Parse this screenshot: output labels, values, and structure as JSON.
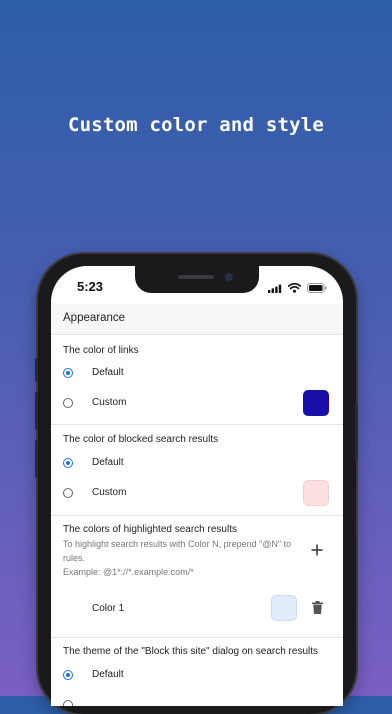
{
  "headline": "Custom color and style",
  "status_bar": {
    "time": "5:23",
    "icons": [
      "signal-icon",
      "wifi-icon",
      "battery-icon"
    ]
  },
  "appbar": {
    "title": "Appearance"
  },
  "sections": {
    "link_color": {
      "title": "The color of links",
      "options": [
        {
          "label": "Default",
          "checked": true
        },
        {
          "label": "Custom",
          "checked": false
        }
      ],
      "swatch_color": "#1a0ea8"
    },
    "blocked_color": {
      "title": "The color of blocked search results",
      "options": [
        {
          "label": "Default",
          "checked": true
        },
        {
          "label": "Custom",
          "checked": false
        }
      ],
      "swatch_color": "#fde0e0"
    },
    "highlight_colors": {
      "title": "The colors of highlighted search results",
      "description": "To highlight search results with Color N, prepend \"@N\" to rules.",
      "example": "Example: @1*://*.example.com/*",
      "add_icon": "plus-icon",
      "items": [
        {
          "label": "Color 1",
          "color": "#e1ecfb",
          "delete_icon": "trash-icon"
        }
      ]
    },
    "dialog_theme": {
      "title": "The theme of the \"Block this site\" dialog on search results",
      "options": [
        {
          "label": "Default",
          "checked": true
        }
      ]
    }
  },
  "colors": {
    "accent": "#1a73e8",
    "background_top": "#2c5ea8",
    "background_bottom": "#7a5fc4"
  }
}
